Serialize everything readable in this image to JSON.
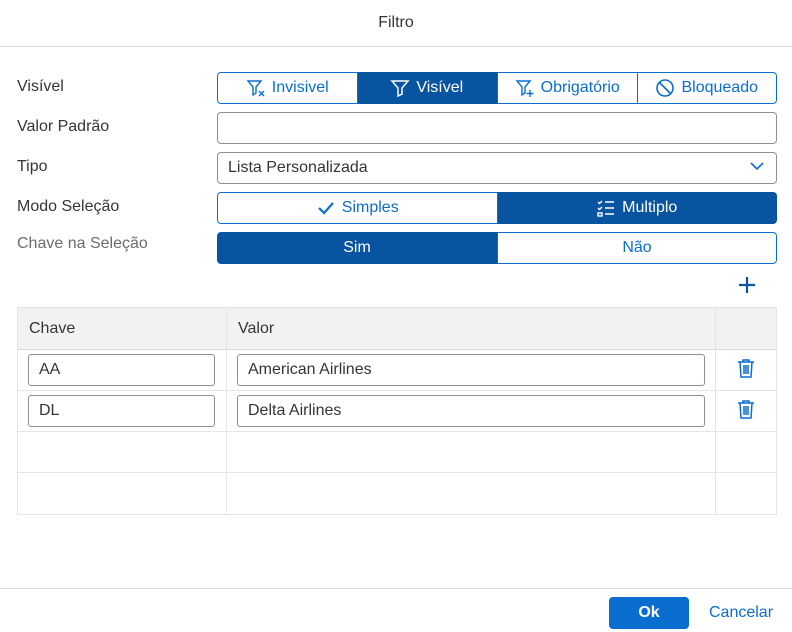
{
  "dialog": {
    "title": "Filtro"
  },
  "form": {
    "visible": {
      "label": "Visível",
      "options": [
        {
          "label": "Invisivel",
          "icon": "filter-x-icon",
          "selected": false
        },
        {
          "label": "Visível",
          "icon": "filter-icon",
          "selected": true
        },
        {
          "label": "Obrigatório",
          "icon": "filter-plus-icon",
          "selected": false
        },
        {
          "label": "Bloqueado",
          "icon": "blocked-icon",
          "selected": false
        }
      ]
    },
    "default_value": {
      "label": "Valor Padrão",
      "value": "",
      "placeholder": ""
    },
    "type": {
      "label": "Tipo",
      "value": "Lista Personalizada"
    },
    "selection_mode": {
      "label": "Modo Seleção",
      "options": [
        {
          "label": "Simples",
          "icon": "checkmark-icon",
          "selected": false
        },
        {
          "label": "Multiplo",
          "icon": "multi-select-list-icon",
          "selected": true
        }
      ]
    },
    "key_in_selection": {
      "label": "Chave na Seleção",
      "options": [
        {
          "label": "Sim",
          "selected": true
        },
        {
          "label": "Não",
          "selected": false
        }
      ]
    }
  },
  "table": {
    "add_icon": "add-icon",
    "columns": {
      "key": "Chave",
      "value": "Valor"
    },
    "rows": [
      {
        "key": "AA",
        "value": "American Airlines",
        "delete_icon": "trash-icon"
      },
      {
        "key": "DL",
        "value": "Delta Airlines",
        "delete_icon": "trash-icon"
      }
    ],
    "empty_rows": 2
  },
  "footer": {
    "ok_label": "Ok",
    "cancel_label": "Cancelar"
  },
  "colors": {
    "accent": "#0a6ed1",
    "selected": "#0854a0",
    "text": "#32363a",
    "border": "#89919a"
  }
}
